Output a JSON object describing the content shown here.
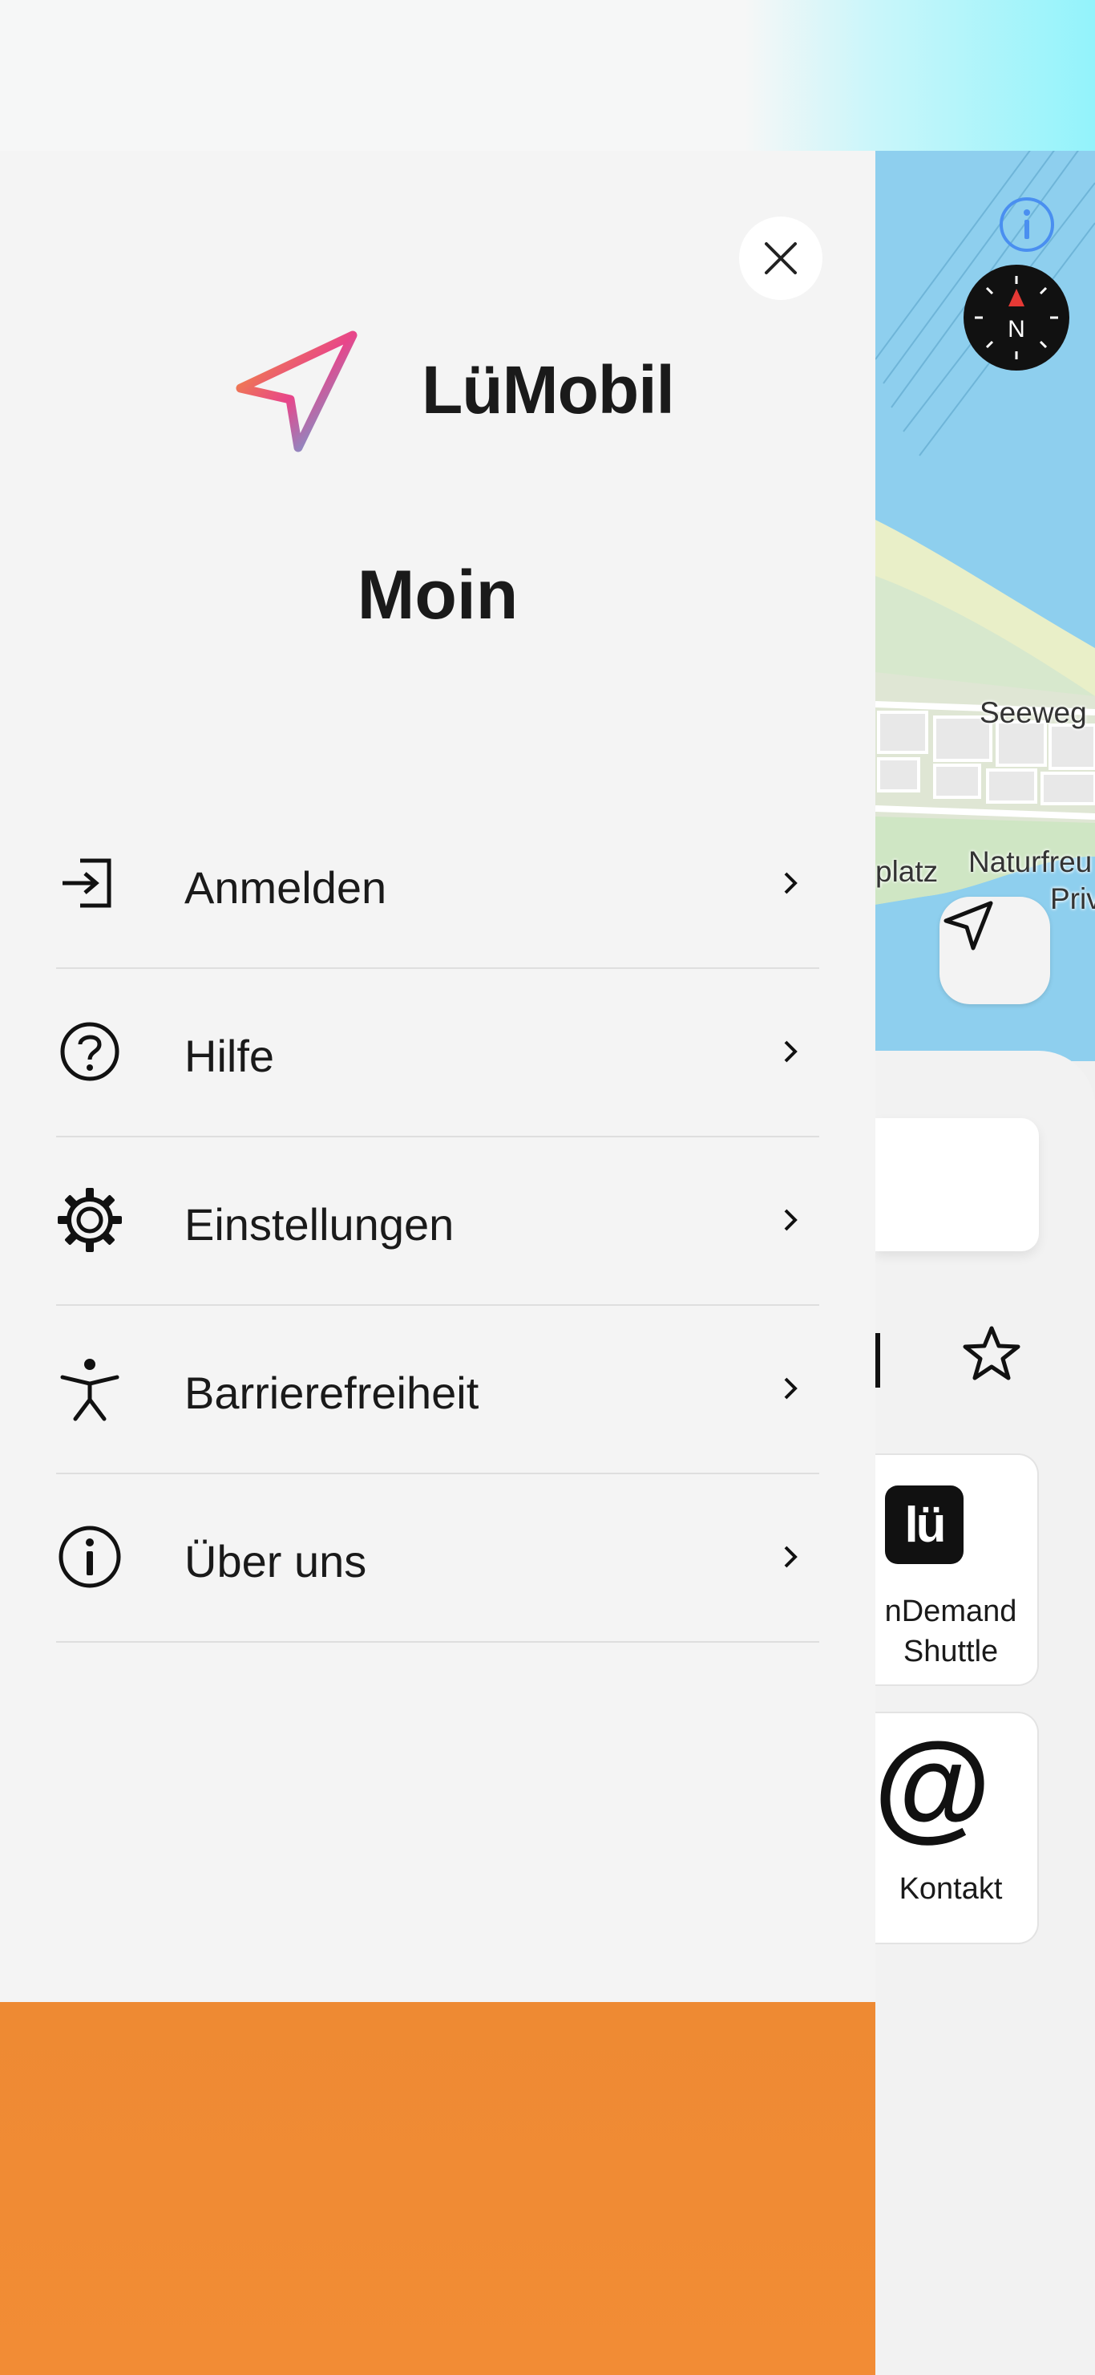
{
  "app": {
    "name": "LüMobil"
  },
  "drawer": {
    "greeting": "Moin",
    "close_label": "close",
    "menu": [
      {
        "id": "login",
        "label": "Anmelden",
        "icon": "login-icon"
      },
      {
        "id": "help",
        "label": "Hilfe",
        "icon": "help-circle-icon"
      },
      {
        "id": "settings",
        "label": "Einstellungen",
        "icon": "gear-icon"
      },
      {
        "id": "accessibility",
        "label": "Barrierefreiheit",
        "icon": "accessibility-icon"
      },
      {
        "id": "about",
        "label": "Über uns",
        "icon": "info-circle-icon"
      }
    ]
  },
  "map": {
    "labels": {
      "street": "Seeweg",
      "place": "platz",
      "nature": "Naturfreu",
      "private": "Priv"
    }
  },
  "sheet": {
    "tiles": [
      {
        "label": "nDemand\nShuttle",
        "icon": "lue-logo-icon",
        "logo_text": "lü"
      },
      {
        "label": "Kontakt",
        "icon": "at-sign-icon",
        "glyph": "@"
      }
    ]
  },
  "colors": {
    "accent_orange": "#f08a34",
    "map_water": "#8ecfee",
    "drawer_bg": "#f4f4f4",
    "info_blue": "#4a8ff0",
    "compass_red": "#e53935"
  }
}
